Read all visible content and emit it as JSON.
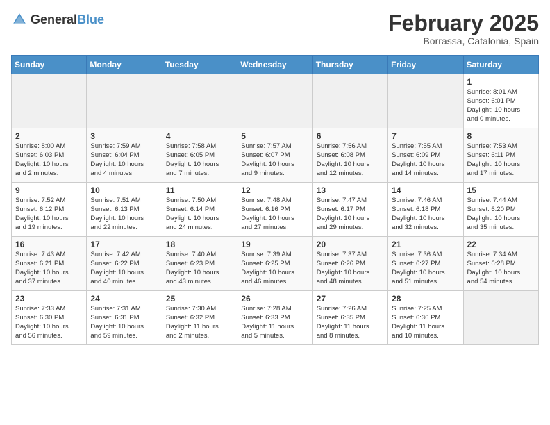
{
  "logo": {
    "general": "General",
    "blue": "Blue"
  },
  "header": {
    "month": "February 2025",
    "location": "Borrassa, Catalonia, Spain"
  },
  "weekdays": [
    "Sunday",
    "Monday",
    "Tuesday",
    "Wednesday",
    "Thursday",
    "Friday",
    "Saturday"
  ],
  "weeks": [
    [
      {
        "day": "",
        "info": ""
      },
      {
        "day": "",
        "info": ""
      },
      {
        "day": "",
        "info": ""
      },
      {
        "day": "",
        "info": ""
      },
      {
        "day": "",
        "info": ""
      },
      {
        "day": "",
        "info": ""
      },
      {
        "day": "1",
        "info": "Sunrise: 8:01 AM\nSunset: 6:01 PM\nDaylight: 10 hours\nand 0 minutes."
      }
    ],
    [
      {
        "day": "2",
        "info": "Sunrise: 8:00 AM\nSunset: 6:03 PM\nDaylight: 10 hours\nand 2 minutes."
      },
      {
        "day": "3",
        "info": "Sunrise: 7:59 AM\nSunset: 6:04 PM\nDaylight: 10 hours\nand 4 minutes."
      },
      {
        "day": "4",
        "info": "Sunrise: 7:58 AM\nSunset: 6:05 PM\nDaylight: 10 hours\nand 7 minutes."
      },
      {
        "day": "5",
        "info": "Sunrise: 7:57 AM\nSunset: 6:07 PM\nDaylight: 10 hours\nand 9 minutes."
      },
      {
        "day": "6",
        "info": "Sunrise: 7:56 AM\nSunset: 6:08 PM\nDaylight: 10 hours\nand 12 minutes."
      },
      {
        "day": "7",
        "info": "Sunrise: 7:55 AM\nSunset: 6:09 PM\nDaylight: 10 hours\nand 14 minutes."
      },
      {
        "day": "8",
        "info": "Sunrise: 7:53 AM\nSunset: 6:11 PM\nDaylight: 10 hours\nand 17 minutes."
      }
    ],
    [
      {
        "day": "9",
        "info": "Sunrise: 7:52 AM\nSunset: 6:12 PM\nDaylight: 10 hours\nand 19 minutes."
      },
      {
        "day": "10",
        "info": "Sunrise: 7:51 AM\nSunset: 6:13 PM\nDaylight: 10 hours\nand 22 minutes."
      },
      {
        "day": "11",
        "info": "Sunrise: 7:50 AM\nSunset: 6:14 PM\nDaylight: 10 hours\nand 24 minutes."
      },
      {
        "day": "12",
        "info": "Sunrise: 7:48 AM\nSunset: 6:16 PM\nDaylight: 10 hours\nand 27 minutes."
      },
      {
        "day": "13",
        "info": "Sunrise: 7:47 AM\nSunset: 6:17 PM\nDaylight: 10 hours\nand 29 minutes."
      },
      {
        "day": "14",
        "info": "Sunrise: 7:46 AM\nSunset: 6:18 PM\nDaylight: 10 hours\nand 32 minutes."
      },
      {
        "day": "15",
        "info": "Sunrise: 7:44 AM\nSunset: 6:20 PM\nDaylight: 10 hours\nand 35 minutes."
      }
    ],
    [
      {
        "day": "16",
        "info": "Sunrise: 7:43 AM\nSunset: 6:21 PM\nDaylight: 10 hours\nand 37 minutes."
      },
      {
        "day": "17",
        "info": "Sunrise: 7:42 AM\nSunset: 6:22 PM\nDaylight: 10 hours\nand 40 minutes."
      },
      {
        "day": "18",
        "info": "Sunrise: 7:40 AM\nSunset: 6:23 PM\nDaylight: 10 hours\nand 43 minutes."
      },
      {
        "day": "19",
        "info": "Sunrise: 7:39 AM\nSunset: 6:25 PM\nDaylight: 10 hours\nand 46 minutes."
      },
      {
        "day": "20",
        "info": "Sunrise: 7:37 AM\nSunset: 6:26 PM\nDaylight: 10 hours\nand 48 minutes."
      },
      {
        "day": "21",
        "info": "Sunrise: 7:36 AM\nSunset: 6:27 PM\nDaylight: 10 hours\nand 51 minutes."
      },
      {
        "day": "22",
        "info": "Sunrise: 7:34 AM\nSunset: 6:28 PM\nDaylight: 10 hours\nand 54 minutes."
      }
    ],
    [
      {
        "day": "23",
        "info": "Sunrise: 7:33 AM\nSunset: 6:30 PM\nDaylight: 10 hours\nand 56 minutes."
      },
      {
        "day": "24",
        "info": "Sunrise: 7:31 AM\nSunset: 6:31 PM\nDaylight: 10 hours\nand 59 minutes."
      },
      {
        "day": "25",
        "info": "Sunrise: 7:30 AM\nSunset: 6:32 PM\nDaylight: 11 hours\nand 2 minutes."
      },
      {
        "day": "26",
        "info": "Sunrise: 7:28 AM\nSunset: 6:33 PM\nDaylight: 11 hours\nand 5 minutes."
      },
      {
        "day": "27",
        "info": "Sunrise: 7:26 AM\nSunset: 6:35 PM\nDaylight: 11 hours\nand 8 minutes."
      },
      {
        "day": "28",
        "info": "Sunrise: 7:25 AM\nSunset: 6:36 PM\nDaylight: 11 hours\nand 10 minutes."
      },
      {
        "day": "",
        "info": ""
      }
    ]
  ]
}
